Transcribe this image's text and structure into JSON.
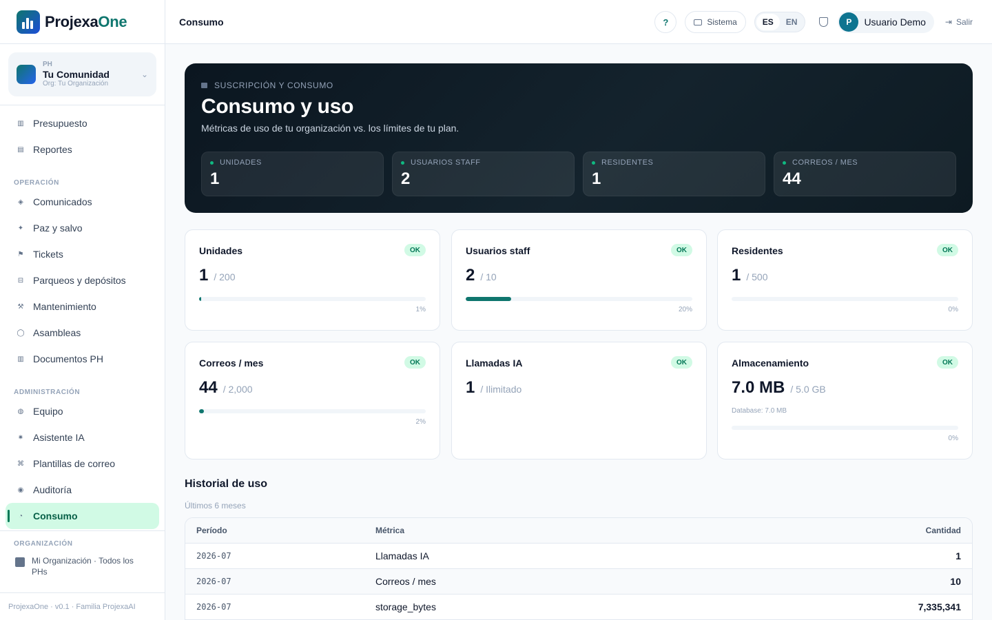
{
  "brand": {
    "name_main": "Projexa",
    "name_accent": "One"
  },
  "community": {
    "tag": "PH",
    "name": "Tu Comunidad",
    "org": "Org: Tu Organización"
  },
  "nav": {
    "top_items": [
      {
        "label": "Presupuesto",
        "icon": "▥"
      },
      {
        "label": "Reportes",
        "icon": "▤"
      }
    ],
    "section_operacion": "OPERACIÓN",
    "operacion_items": [
      {
        "label": "Comunicados",
        "icon": "◈"
      },
      {
        "label": "Paz y salvo",
        "icon": "✦"
      },
      {
        "label": "Tickets",
        "icon": "⚑"
      },
      {
        "label": "Parqueos y depósitos",
        "icon": "⊟"
      },
      {
        "label": "Mantenimiento",
        "icon": "⚒"
      },
      {
        "label": "Asambleas",
        "icon": "◯"
      },
      {
        "label": "Documentos PH",
        "icon": "▥"
      }
    ],
    "section_administracion": "ADMINISTRACIÓN",
    "admin_items": [
      {
        "label": "Equipo",
        "icon": "◍"
      },
      {
        "label": "Asistente IA",
        "icon": "✷"
      },
      {
        "label": "Plantillas de correo",
        "icon": "⌘"
      },
      {
        "label": "Auditoría",
        "icon": "◉"
      },
      {
        "label": "Consumo",
        "icon": "◔"
      }
    ]
  },
  "org_section": {
    "label": "ORGANIZACIÓN",
    "item": "Mi Organización · Todos los PHs"
  },
  "footer": "ProjexaOne · v0.1 · Familia ProjexaAI",
  "topbar": {
    "title": "Consumo",
    "help": "?",
    "system_label": "Sistema",
    "lang_es": "ES",
    "lang_en": "EN",
    "user_initial": "P",
    "user_name": "Usuario Demo",
    "logout": "Salir"
  },
  "hero": {
    "tag": "SUSCRIPCIÓN Y CONSUMO",
    "title": "Consumo y uso",
    "subtitle": "Métricas de uso de tu organización vs. los límites de tu plan.",
    "stats": [
      {
        "label": "UNIDADES",
        "value": "1"
      },
      {
        "label": "USUARIOS STAFF",
        "value": "2"
      },
      {
        "label": "RESIDENTES",
        "value": "1"
      },
      {
        "label": "CORREOS / MES",
        "value": "44"
      }
    ]
  },
  "cards": [
    {
      "title": "Unidades",
      "status": "OK",
      "value": "1",
      "limit": "/ 200",
      "fill": 0.01,
      "pct": "1%"
    },
    {
      "title": "Usuarios staff",
      "status": "OK",
      "value": "2",
      "limit": "/ 10",
      "fill": 0.2,
      "pct": "20%"
    },
    {
      "title": "Residentes",
      "status": "OK",
      "value": "1",
      "limit": "/ 500",
      "fill": 0.0,
      "pct": "0%"
    },
    {
      "title": "Correos / mes",
      "status": "OK",
      "value": "44",
      "limit": "/ 2,000",
      "fill": 0.02,
      "pct": "2%"
    },
    {
      "title": "Llamadas IA",
      "status": "OK",
      "value": "1",
      "limit": "/ Ilimitado"
    },
    {
      "title": "Almacenamiento",
      "status": "OK",
      "value": "7.0 MB",
      "limit": "/ 5.0 GB",
      "note": "Database: 7.0 MB",
      "fill": 0.0,
      "pct": "0%"
    }
  ],
  "history": {
    "title": "Historial de uso",
    "subtitle": "Últimos 6 meses",
    "headers": {
      "period": "Período",
      "metric": "Métrica",
      "qty": "Cantidad"
    },
    "rows": [
      {
        "period": "2026-07",
        "metric": "Llamadas IA",
        "qty": "1"
      },
      {
        "period": "2026-07",
        "metric": "Correos / mes",
        "qty": "10"
      },
      {
        "period": "2026-07",
        "metric": "storage_bytes",
        "qty": "7,335,341"
      }
    ]
  },
  "colors": {
    "accent": "#0f766e",
    "ok_bg": "#d1fae5",
    "ok_text": "#047857",
    "hero_bg": "#0b1620"
  }
}
